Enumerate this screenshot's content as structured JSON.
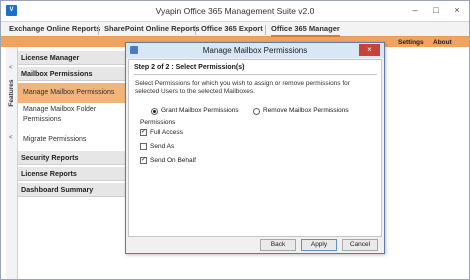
{
  "app": {
    "title": "Vyapin Office 365 Management Suite v2.0",
    "icon": "app-logo-icon",
    "window_buttons": {
      "minimize": "–",
      "maximize": "□",
      "close": "×"
    }
  },
  "topnav": {
    "tabs": [
      {
        "label": "Exchange Online Reports"
      },
      {
        "label": "SharePoint Online Reports"
      },
      {
        "label": "Office 365 Export"
      },
      {
        "label": "Office 365 Manager",
        "active": true
      }
    ]
  },
  "strip": {
    "settings": "Settings",
    "about": "About"
  },
  "features": {
    "label": "Features"
  },
  "sidebar": {
    "license_manager": "License Manager",
    "mailbox_permissions": "Mailbox Permissions",
    "manage_mailbox_permissions": "Manage Mailbox Permissions",
    "manage_folder_line1": "Manage Mailbox Folder",
    "manage_folder_line2": "Permissions",
    "migrate_permissions": "Migrate Permissions",
    "security_reports": "Security Reports",
    "license_reports": "License Reports",
    "dashboard_summary": "Dashboard Summary"
  },
  "dialog": {
    "title": "Manage Mailbox Permissions",
    "close": "×",
    "step": "Step 2 of 2 : Select Permission(s)",
    "instruction": "Select Permissions for which you wish to assign or remove permissions for selected Users to the selected Mailboxes.",
    "radio_grant": "Grant Mailbox Permissions",
    "radio_remove": "Remove Mailbox Permissions",
    "permissions_label": "Permissions",
    "full_access": "Full Access",
    "send_as": "Send As",
    "send_on_behalf": "Send On Behalf",
    "check_mark": "✓",
    "back": "Back",
    "apply": "Apply",
    "cancel": "Cancel"
  },
  "colors": {
    "accent_orange": "#f0a35e",
    "active_sidebar": "#f3b47a",
    "dialog_close_red": "#c8423a"
  }
}
